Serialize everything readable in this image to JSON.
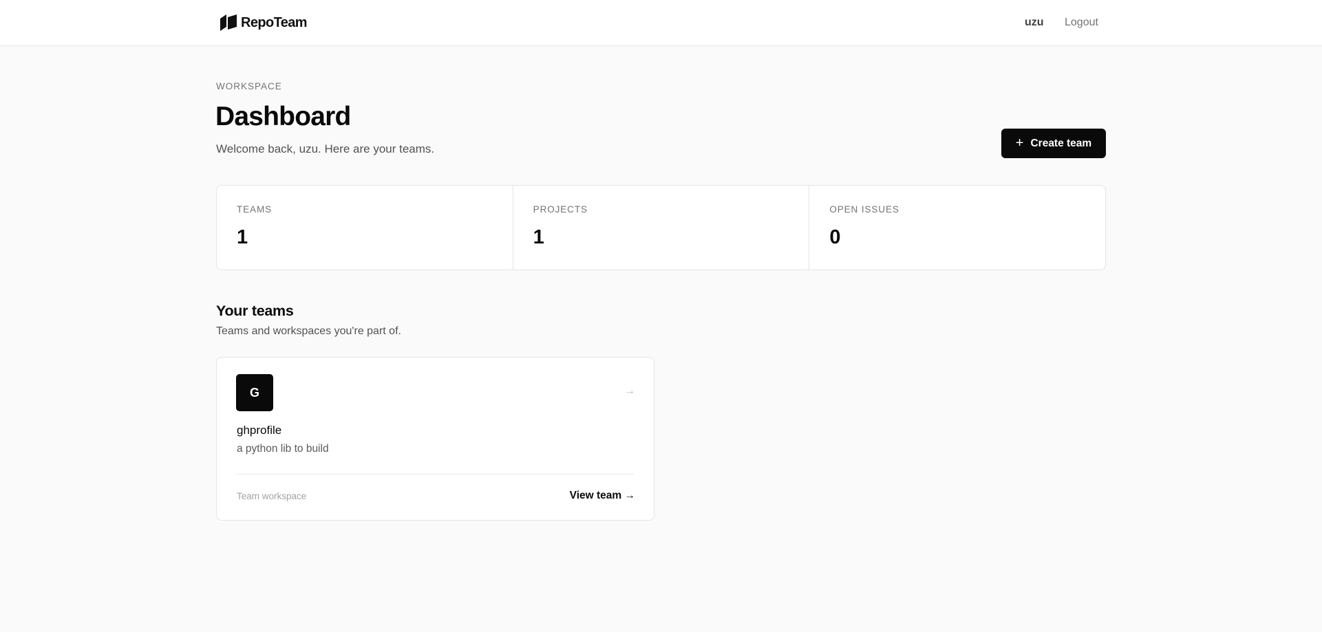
{
  "header": {
    "brand": "RepoTeam",
    "logo_icon": "repoteam-logo-icon",
    "user": "uzu",
    "logout_label": "Logout"
  },
  "page": {
    "eyebrow": "WORKSPACE",
    "title": "Dashboard",
    "subtitle": "Welcome back, uzu. Here are your teams.",
    "create_button": {
      "icon": "plus-icon",
      "label": "Create team"
    }
  },
  "stats": [
    {
      "label": "TEAMS",
      "value": "1"
    },
    {
      "label": "PROJECTS",
      "value": "1"
    },
    {
      "label": "OPEN ISSUES",
      "value": "0"
    }
  ],
  "teams_section": {
    "title": "Your teams",
    "subtitle": "Teams and workspaces you're part of.",
    "teams": [
      {
        "initial": "G",
        "name": "ghprofile",
        "description": "a python lib to build",
        "meta": "Team workspace",
        "arrow": "→",
        "view_label": "View team →"
      }
    ]
  },
  "colors": {
    "background": "#fafafa",
    "surface": "#ffffff",
    "primary": "#0a0a0a",
    "border": "#e5e5e5",
    "muted_text": "#737373"
  }
}
